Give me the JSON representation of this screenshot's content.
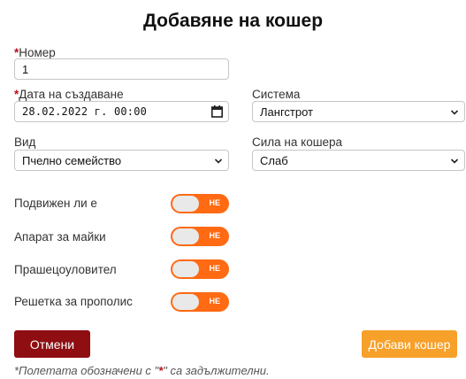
{
  "title": "Добавяне на кошер",
  "fields": {
    "number": {
      "required_mark": "*",
      "label": "Номер",
      "value": "1"
    },
    "created_at": {
      "required_mark": "*",
      "label": "Дата на създаване",
      "value": "28.02.2022 г. 00:00"
    },
    "system": {
      "label": "Система",
      "value": "Лангстрот"
    },
    "type": {
      "label": "Вид",
      "value": "Пчелно семейство"
    },
    "strength": {
      "label": "Сила на кошера",
      "value": "Слаб"
    }
  },
  "toggles": [
    {
      "label": "Подвижен ли е",
      "state": "НЕ"
    },
    {
      "label": "Апарат за майки",
      "state": "НЕ"
    },
    {
      "label": "Прашецоуловител",
      "state": "НЕ"
    },
    {
      "label": "Решетка за прополис",
      "state": "НЕ"
    }
  ],
  "buttons": {
    "cancel": "Отмени",
    "add": "Добави кошер"
  },
  "footnote": {
    "before": "*Полетата обозначени с \"",
    "star": "*",
    "after": "\" са задължителни."
  },
  "colors": {
    "toggle": "#ff6a13",
    "cancel": "#8e0e12",
    "add": "#f7a02a",
    "required": "#b5121b"
  }
}
